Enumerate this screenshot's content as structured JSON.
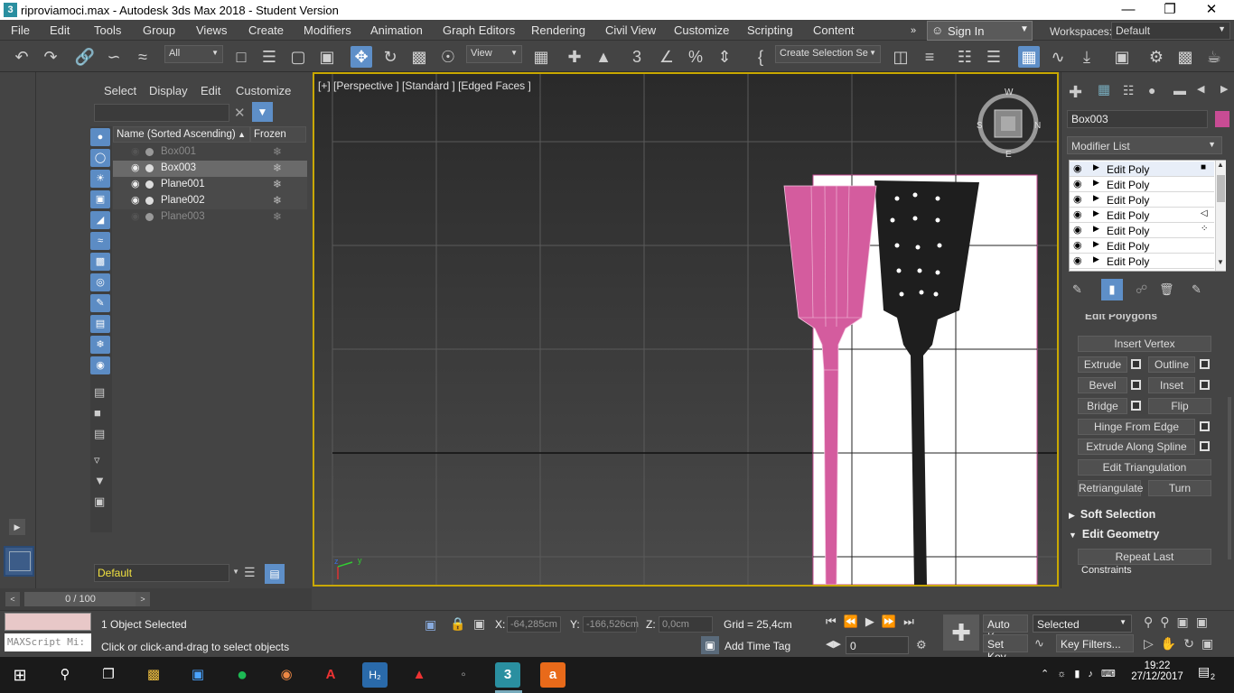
{
  "window": {
    "app_icon": "3",
    "title": "riproviamoci.max - Autodesk 3ds Max 2018 - Student Version",
    "minimize_icon": "minimize-icon",
    "maximize_icon": "restore-icon",
    "close_icon": "close-icon"
  },
  "menu": [
    "File",
    "Edit",
    "Tools",
    "Group",
    "Views",
    "Create",
    "Modifiers",
    "Animation",
    "Graph Editors",
    "Rendering",
    "Civil View",
    "Customize",
    "Scripting",
    "Content"
  ],
  "signin": {
    "label": "Sign In"
  },
  "workspaces": {
    "label": "Workspaces:",
    "value": "Default"
  },
  "toolbar": {
    "selection_filter": "All",
    "reference_coord": "View",
    "named_selection": "Create Selection Se"
  },
  "scene_explorer": {
    "tabs": [
      "Select",
      "Display",
      "Edit",
      "Customize"
    ],
    "search_placeholder": "",
    "columns": [
      "Name (Sorted Ascending)",
      "Frozen"
    ],
    "rows": [
      {
        "name": "Box001",
        "visible": false,
        "selected": false,
        "dim": true
      },
      {
        "name": "Box003",
        "visible": true,
        "selected": true,
        "dim": false
      },
      {
        "name": "Plane001",
        "visible": true,
        "selected": false,
        "dim": false
      },
      {
        "name": "Plane002",
        "visible": true,
        "selected": false,
        "dim": false
      },
      {
        "name": "Plane003",
        "visible": false,
        "selected": false,
        "dim": true
      }
    ],
    "layer": "Default"
  },
  "viewport": {
    "label": "[+] [Perspective ] [Standard ] [Edged Faces ]",
    "viewcube_letters": [
      "W",
      "S",
      "E",
      "N"
    ],
    "axis": {
      "z": "z",
      "y": "y"
    }
  },
  "command_panel": {
    "object_name": "Box003",
    "object_color": "#c84c94",
    "modifier_list": "Modifier List",
    "stack": [
      {
        "label": "Edit Poly",
        "mark": "■"
      },
      {
        "label": "Edit Poly",
        "mark": ""
      },
      {
        "label": "Edit Poly",
        "mark": ""
      },
      {
        "label": "Edit Poly",
        "mark": "◁"
      },
      {
        "label": "Edit Poly",
        "mark": "⁘"
      },
      {
        "label": "Edit Poly",
        "mark": ""
      },
      {
        "label": "Edit Poly",
        "mark": ""
      }
    ],
    "rollout_partial": "Edit Polygons",
    "buttons": {
      "insert_vertex": "Insert Vertex",
      "extrude": "Extrude",
      "outline": "Outline",
      "bevel": "Bevel",
      "inset": "Inset",
      "bridge": "Bridge",
      "flip": "Flip",
      "hinge": "Hinge From Edge",
      "extrude_spline": "Extrude Along Spline",
      "edit_tri": "Edit Triangulation",
      "retri": "Retriangulate",
      "turn": "Turn",
      "repeat_last": "Repeat Last"
    },
    "soft_selection": "Soft Selection",
    "edit_geometry": "Edit Geometry",
    "constraints": "Constraints"
  },
  "timeslider": {
    "value": "0 / 100"
  },
  "status": {
    "maxscript": "MAXScript Mi:",
    "selected": "1 Object Selected",
    "prompt": "Click or click-and-drag to select objects",
    "x_label": "X:",
    "x": "-64,285cm",
    "y_label": "Y:",
    "y": "-166,526cm",
    "z_label": "Z:",
    "z": "0,0cm",
    "grid": "Grid = 25,4cm",
    "add_time_tag": "Add Time Tag",
    "auto_key": "Auto Key",
    "set_key": "Set Key",
    "key_mode": "Selected",
    "key_filters": "Key Filters...",
    "frame": "0"
  },
  "taskbar": {
    "time": "19:22",
    "date": "27/12/2017",
    "notifications": "2"
  }
}
